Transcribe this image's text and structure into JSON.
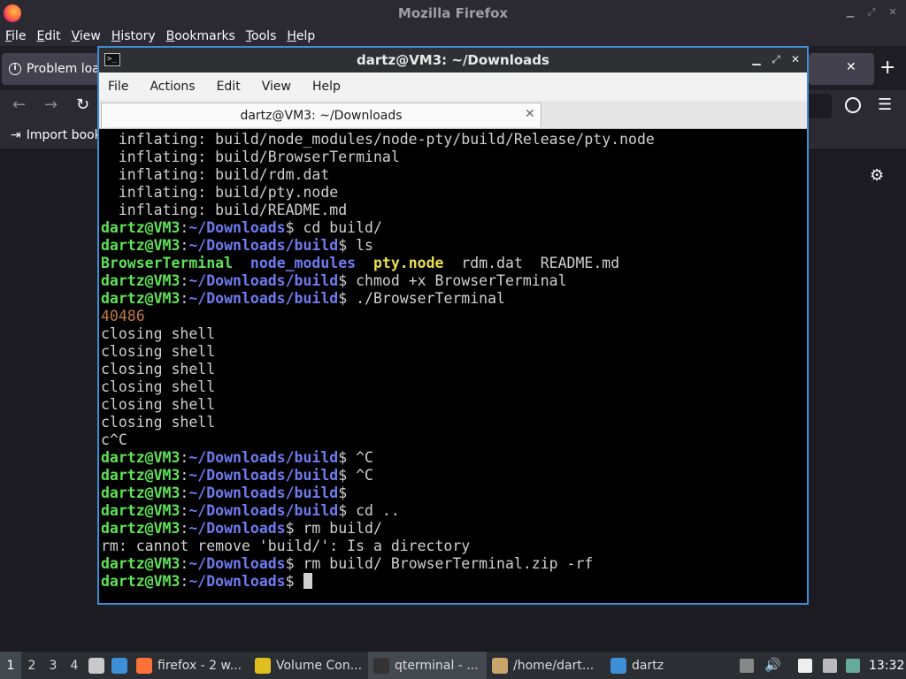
{
  "firefox": {
    "window_title": "Mozilla Firefox",
    "menu": [
      "File",
      "Edit",
      "View",
      "History",
      "Bookmarks",
      "Tools",
      "Help"
    ],
    "tab_label": "Problem loa",
    "tab_close": "✕",
    "new_tab": "+",
    "bookmark_item": "Import book"
  },
  "terminal": {
    "window_title": "dartz@VM3: ~/Downloads",
    "menu": [
      "File",
      "Actions",
      "Edit",
      "View",
      "Help"
    ],
    "tab_label": "dartz@VM3: ~/Downloads",
    "tab_close": "✕",
    "lines": [
      [
        {
          "t": "  inflating: build/node_modules/node-pty/build/Release/pty.node",
          "c": ""
        }
      ],
      [
        {
          "t": "  inflating: build/BrowserTerminal",
          "c": ""
        }
      ],
      [
        {
          "t": "  inflating: build/rdm.dat",
          "c": ""
        }
      ],
      [
        {
          "t": "  inflating: build/pty.node",
          "c": ""
        }
      ],
      [
        {
          "t": "  inflating: build/README.md",
          "c": ""
        }
      ],
      [
        {
          "t": "dartz@VM3",
          "c": "p-user"
        },
        {
          "t": ":",
          "c": ""
        },
        {
          "t": "~/Downloads",
          "c": "p-path"
        },
        {
          "t": "$ cd build/",
          "c": ""
        }
      ],
      [
        {
          "t": "dartz@VM3",
          "c": "p-user"
        },
        {
          "t": ":",
          "c": ""
        },
        {
          "t": "~/Downloads/build",
          "c": "p-path"
        },
        {
          "t": "$ ls",
          "c": ""
        }
      ],
      [
        {
          "t": "BrowserTerminal",
          "c": "c-green"
        },
        {
          "t": "  ",
          "c": ""
        },
        {
          "t": "node_modules",
          "c": "c-blue"
        },
        {
          "t": "  ",
          "c": ""
        },
        {
          "t": "pty.node",
          "c": "c-yellow"
        },
        {
          "t": "  rdm.dat  README.md",
          "c": ""
        }
      ],
      [
        {
          "t": "dartz@VM3",
          "c": "p-user"
        },
        {
          "t": ":",
          "c": ""
        },
        {
          "t": "~/Downloads/build",
          "c": "p-path"
        },
        {
          "t": "$ chmod +x BrowserTerminal",
          "c": ""
        }
      ],
      [
        {
          "t": "dartz@VM3",
          "c": "p-user"
        },
        {
          "t": ":",
          "c": ""
        },
        {
          "t": "~/Downloads/build",
          "c": "p-path"
        },
        {
          "t": "$ ./BrowserTerminal",
          "c": ""
        }
      ],
      [
        {
          "t": "40486",
          "c": "c-brown"
        }
      ],
      [
        {
          "t": "closing shell",
          "c": ""
        }
      ],
      [
        {
          "t": "closing shell",
          "c": ""
        }
      ],
      [
        {
          "t": "closing shell",
          "c": ""
        }
      ],
      [
        {
          "t": "closing shell",
          "c": ""
        }
      ],
      [
        {
          "t": "closing shell",
          "c": ""
        }
      ],
      [
        {
          "t": "closing shell",
          "c": ""
        }
      ],
      [
        {
          "t": "c^C",
          "c": ""
        }
      ],
      [
        {
          "t": "dartz@VM3",
          "c": "p-user"
        },
        {
          "t": ":",
          "c": ""
        },
        {
          "t": "~/Downloads/build",
          "c": "p-path"
        },
        {
          "t": "$ ^C",
          "c": ""
        }
      ],
      [
        {
          "t": "dartz@VM3",
          "c": "p-user"
        },
        {
          "t": ":",
          "c": ""
        },
        {
          "t": "~/Downloads/build",
          "c": "p-path"
        },
        {
          "t": "$ ^C",
          "c": ""
        }
      ],
      [
        {
          "t": "dartz@VM3",
          "c": "p-user"
        },
        {
          "t": ":",
          "c": ""
        },
        {
          "t": "~/Downloads/build",
          "c": "p-path"
        },
        {
          "t": "$",
          "c": ""
        }
      ],
      [
        {
          "t": "dartz@VM3",
          "c": "p-user"
        },
        {
          "t": ":",
          "c": ""
        },
        {
          "t": "~/Downloads/build",
          "c": "p-path"
        },
        {
          "t": "$ cd ..",
          "c": ""
        }
      ],
      [
        {
          "t": "dartz@VM3",
          "c": "p-user"
        },
        {
          "t": ":",
          "c": ""
        },
        {
          "t": "~/Downloads",
          "c": "p-path"
        },
        {
          "t": "$ rm build/",
          "c": ""
        }
      ],
      [
        {
          "t": "rm: cannot remove 'build/': Is a directory",
          "c": ""
        }
      ],
      [
        {
          "t": "dartz@VM3",
          "c": "p-user"
        },
        {
          "t": ":",
          "c": ""
        },
        {
          "t": "~/Downloads",
          "c": "p-path"
        },
        {
          "t": "$ rm build/ BrowserTerminal.zip -rf",
          "c": ""
        }
      ],
      [
        {
          "t": "dartz@VM3",
          "c": "p-user"
        },
        {
          "t": ":",
          "c": ""
        },
        {
          "t": "~/Downloads",
          "c": "p-path"
        },
        {
          "t": "$ ",
          "c": ""
        },
        {
          "t": "",
          "c": "cursor"
        }
      ]
    ]
  },
  "taskbar": {
    "workspaces": [
      "1",
      "2",
      "3",
      "4"
    ],
    "apps": [
      {
        "label": "firefox - 2 w...",
        "icon": "firefox-icon",
        "color": "#ff7139"
      },
      {
        "label": "Volume Con...",
        "icon": "volume-control-icon",
        "color": "#e0c020"
      },
      {
        "label": "qterminal - ...",
        "icon": "terminal-icon",
        "color": "#333333"
      },
      {
        "label": "/home/dart...",
        "icon": "file-manager-icon",
        "color": "#c9a66b"
      },
      {
        "label": "dartz",
        "icon": "folder-icon",
        "color": "#3d8fd6"
      }
    ],
    "clock": "13:32"
  }
}
